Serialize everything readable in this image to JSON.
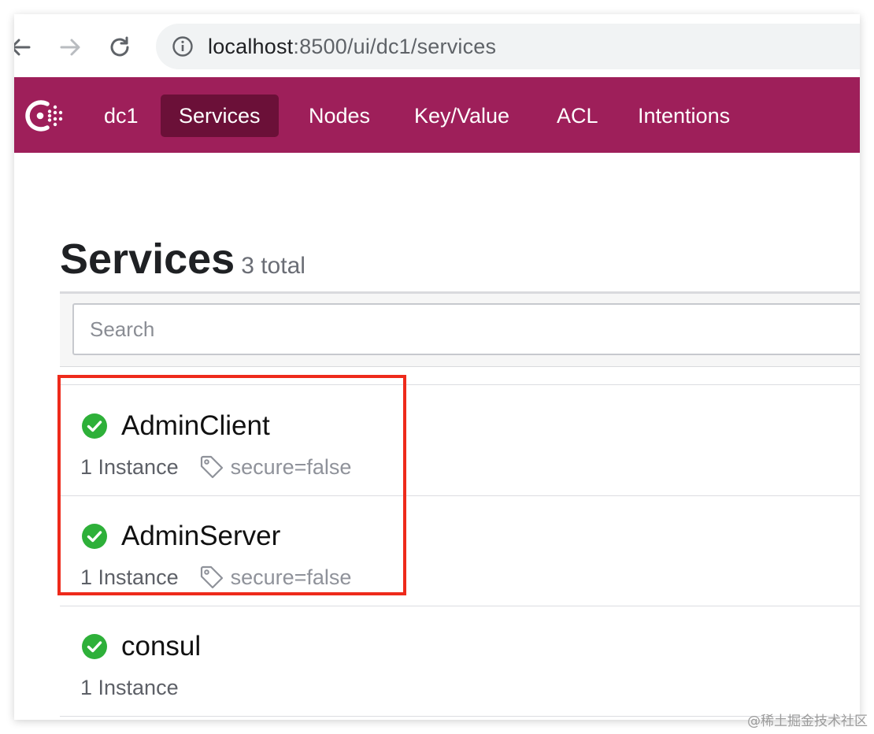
{
  "browser": {
    "url_host": "localhost",
    "url_rest": ":8500/ui/dc1/services"
  },
  "topnav": {
    "datacenter": "dc1",
    "items": [
      {
        "label": "Services",
        "active": true
      },
      {
        "label": "Nodes",
        "active": false
      },
      {
        "label": "Key/Value",
        "active": false
      },
      {
        "label": "ACL",
        "active": false
      },
      {
        "label": "Intentions",
        "active": false
      }
    ]
  },
  "page": {
    "title": "Services",
    "count": "3 total"
  },
  "search": {
    "placeholder": "Search"
  },
  "services": [
    {
      "name": "AdminClient",
      "status": "passing",
      "instances": "1 Instance",
      "tag": "secure=false"
    },
    {
      "name": "AdminServer",
      "status": "passing",
      "instances": "1 Instance",
      "tag": "secure=false"
    },
    {
      "name": "consul",
      "status": "passing",
      "instances": "1 Instance",
      "tag": ""
    }
  ],
  "watermark": "@稀土掘金技术社区",
  "colors": {
    "nav_background": "#9e1f5a",
    "nav_active": "#6b1038",
    "status_passing": "#2eb039",
    "highlight_box": "#ee2a1b"
  },
  "icons": {
    "back": "arrow-left-icon",
    "forward": "arrow-right-icon",
    "reload": "reload-icon",
    "site_info": "info-icon",
    "logo": "consul-logo",
    "status": "check-circle-icon",
    "tag": "tag-icon"
  }
}
